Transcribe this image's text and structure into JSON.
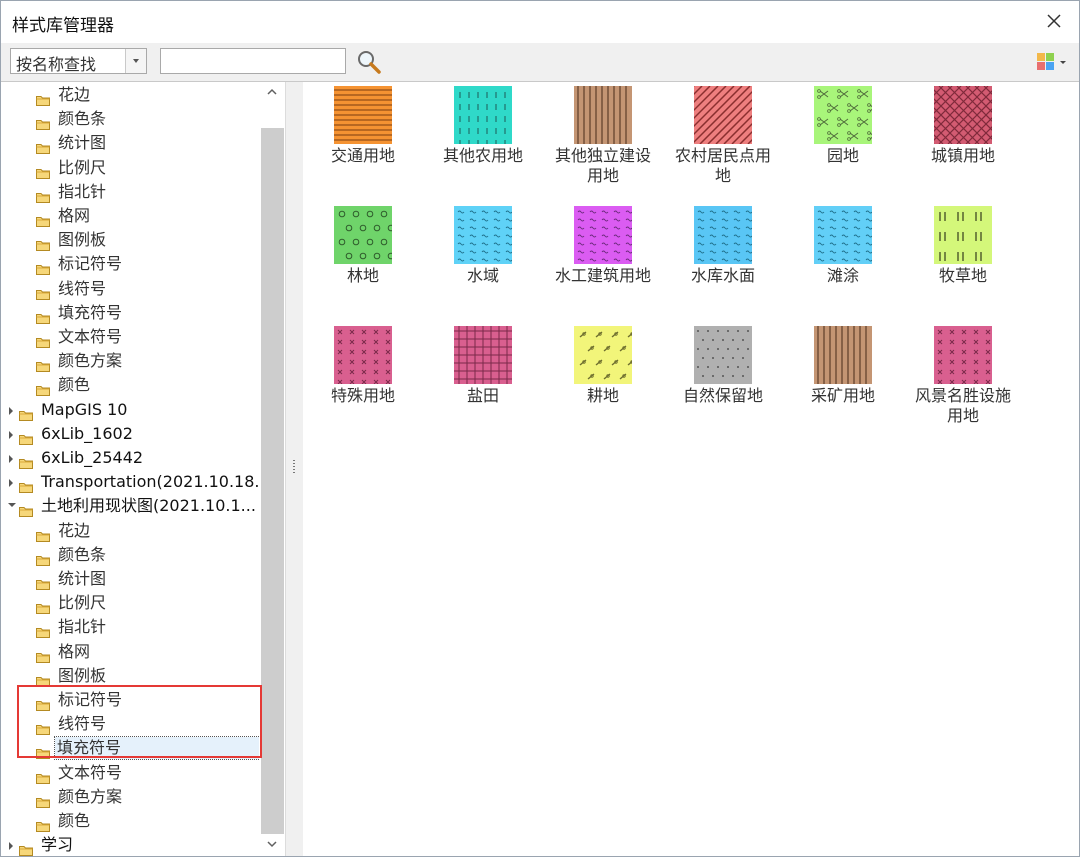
{
  "window": {
    "title": "样式库管理器"
  },
  "toolbar": {
    "search_mode": "按名称查找",
    "search_value": ""
  },
  "tree": [
    {
      "label": "花边",
      "level": 2,
      "expander": ""
    },
    {
      "label": "颜色条",
      "level": 2,
      "expander": ""
    },
    {
      "label": "统计图",
      "level": 2,
      "expander": ""
    },
    {
      "label": "比例尺",
      "level": 2,
      "expander": ""
    },
    {
      "label": "指北针",
      "level": 2,
      "expander": ""
    },
    {
      "label": "格网",
      "level": 2,
      "expander": ""
    },
    {
      "label": "图例板",
      "level": 2,
      "expander": ""
    },
    {
      "label": "标记符号",
      "level": 2,
      "expander": ""
    },
    {
      "label": "线符号",
      "level": 2,
      "expander": ""
    },
    {
      "label": "填充符号",
      "level": 2,
      "expander": ""
    },
    {
      "label": "文本符号",
      "level": 2,
      "expander": ""
    },
    {
      "label": "颜色方案",
      "level": 2,
      "expander": ""
    },
    {
      "label": "颜色",
      "level": 2,
      "expander": ""
    },
    {
      "label": "MapGIS 10",
      "level": 1,
      "expander": "collapsed"
    },
    {
      "label": "6xLib_1602",
      "level": 1,
      "expander": "collapsed"
    },
    {
      "label": "6xLib_25442",
      "level": 1,
      "expander": "collapsed"
    },
    {
      "label": "Transportation(2021.10.18...",
      "level": 1,
      "expander": "collapsed"
    },
    {
      "label": "土地利用现状图(2021.10.1...",
      "level": 1,
      "expander": "expanded"
    },
    {
      "label": "花边",
      "level": 2,
      "expander": ""
    },
    {
      "label": "颜色条",
      "level": 2,
      "expander": ""
    },
    {
      "label": "统计图",
      "level": 2,
      "expander": ""
    },
    {
      "label": "比例尺",
      "level": 2,
      "expander": ""
    },
    {
      "label": "指北针",
      "level": 2,
      "expander": ""
    },
    {
      "label": "格网",
      "level": 2,
      "expander": ""
    },
    {
      "label": "图例板",
      "level": 2,
      "expander": ""
    },
    {
      "label": "标记符号",
      "level": 2,
      "expander": ""
    },
    {
      "label": "线符号",
      "level": 2,
      "expander": ""
    },
    {
      "label": "填充符号",
      "level": 2,
      "expander": "",
      "selected": true
    },
    {
      "label": "文本符号",
      "level": 2,
      "expander": ""
    },
    {
      "label": "颜色方案",
      "level": 2,
      "expander": ""
    },
    {
      "label": "颜色",
      "level": 2,
      "expander": ""
    },
    {
      "label": "学习",
      "level": 1,
      "expander": "collapsed"
    }
  ],
  "symbols": [
    {
      "label": "交通用地",
      "bg": "#f59332",
      "pattern": "hlines",
      "fg": "#7a3e10"
    },
    {
      "label": "其他农用地",
      "bg": "#2fd9c9",
      "pattern": "ticks",
      "fg": "#20706a"
    },
    {
      "label": "其他独立建设用地",
      "bg": "#c49573",
      "pattern": "vlines",
      "fg": "#5e3d28"
    },
    {
      "label": "农村居民点用地",
      "bg": "#ee7f7f",
      "pattern": "diag",
      "fg": "#8a2f2f"
    },
    {
      "label": "园地",
      "bg": "#a8f57a",
      "pattern": "scissors",
      "fg": "#4f6b3b"
    },
    {
      "label": "城镇用地",
      "bg": "#d35b72",
      "pattern": "crossdiag",
      "fg": "#7f2a3b"
    },
    {
      "label": "林地",
      "bg": "#6fd46a",
      "pattern": "circles",
      "fg": "#2f5b2c"
    },
    {
      "label": "水域",
      "bg": "#5fd2f7",
      "pattern": "waves",
      "fg": "#1f6f8a"
    },
    {
      "label": "水工建筑用地",
      "bg": "#db5cf2",
      "pattern": "waves",
      "fg": "#6a2a7a"
    },
    {
      "label": "水库水面",
      "bg": "#59c6f5",
      "pattern": "waves",
      "fg": "#1f6f8a"
    },
    {
      "label": "滩涂",
      "bg": "#62cff7",
      "pattern": "waves",
      "fg": "#1f6f8a"
    },
    {
      "label": "牧草地",
      "bg": "#d4f77a",
      "pattern": "bars",
      "fg": "#55602e"
    },
    {
      "label": "特殊用地",
      "bg": "#d95f8f",
      "pattern": "xs",
      "fg": "#7a2a4a"
    },
    {
      "label": "盐田",
      "bg": "#d95f8f",
      "pattern": "grid",
      "fg": "#7a2a4a"
    },
    {
      "label": "耕地",
      "bg": "#f2f57a",
      "pattern": "leaves",
      "fg": "#6d6d2e"
    },
    {
      "label": "自然保留地",
      "bg": "#b0b0b0",
      "pattern": "dots",
      "fg": "#555555"
    },
    {
      "label": "采矿用地",
      "bg": "#c49573",
      "pattern": "vlines",
      "fg": "#5e3d28"
    },
    {
      "label": "风景名胜设施用地",
      "bg": "#d95f8f",
      "pattern": "xs",
      "fg": "#7a2a4a"
    }
  ]
}
